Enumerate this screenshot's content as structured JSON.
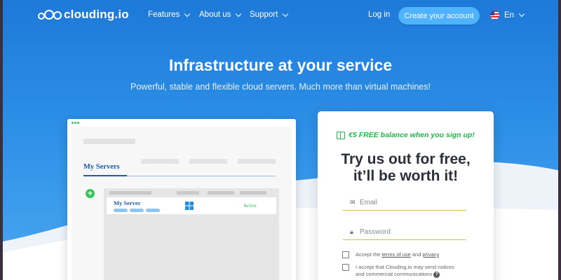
{
  "nav": {
    "logo_text": "clouding.io",
    "items": [
      {
        "label": "Features"
      },
      {
        "label": "About us"
      },
      {
        "label": "Support"
      }
    ],
    "login_label": "Log in",
    "cta_label": "Create your account",
    "language": "En"
  },
  "hero": {
    "title": "Infrastructure at your service",
    "subtitle": "Powerful, stable and flexible cloud servers. Much more than virtual machines!"
  },
  "mock": {
    "tab_label": "My Servers",
    "server_name": "My Server",
    "server_status": "Active"
  },
  "signup": {
    "promo": "€5 FREE balance when you sign up!",
    "title_line1": "Try us out for free,",
    "title_line2": "it’ll be worth it!",
    "email_placeholder": "Email",
    "password_placeholder": "Password",
    "terms_prefix": "Accept the ",
    "terms_link": "terms of use",
    "terms_and": " and ",
    "privacy_link": "privacy",
    "notices_line1": "I accept that Clouding.io may send notices",
    "notices_line2": "and commercial communications"
  },
  "colors": {
    "accent": "#4fb3ff",
    "promo_green": "#22b84a",
    "brand_blue": "#1e79d8"
  }
}
